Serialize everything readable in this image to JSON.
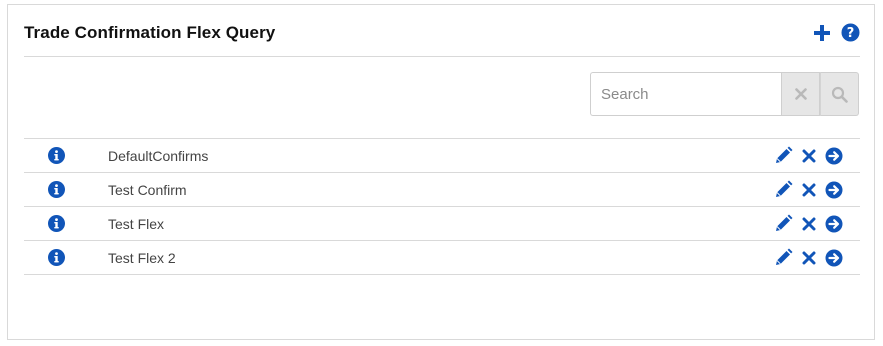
{
  "panel": {
    "title": "Trade Confirmation Flex Query",
    "header_icons": [
      "plus-icon",
      "question-circle-icon"
    ]
  },
  "search": {
    "placeholder": "Search",
    "value": "",
    "clear_icon": "close-icon",
    "search_icon": "magnifier-icon"
  },
  "queries": [
    {
      "name": "DefaultConfirms"
    },
    {
      "name": "Test Confirm"
    },
    {
      "name": "Test Flex"
    },
    {
      "name": "Test Flex 2"
    }
  ],
  "row_icons": {
    "info": "info-circle-icon",
    "edit": "pencil-icon",
    "delete": "close-icon",
    "run": "arrow-circle-right-icon"
  },
  "colors": {
    "accent": "#1155b8",
    "border": "#d9d9d9",
    "button_bg": "#e6e6e6",
    "disabled_icon": "#b9b9b9"
  }
}
